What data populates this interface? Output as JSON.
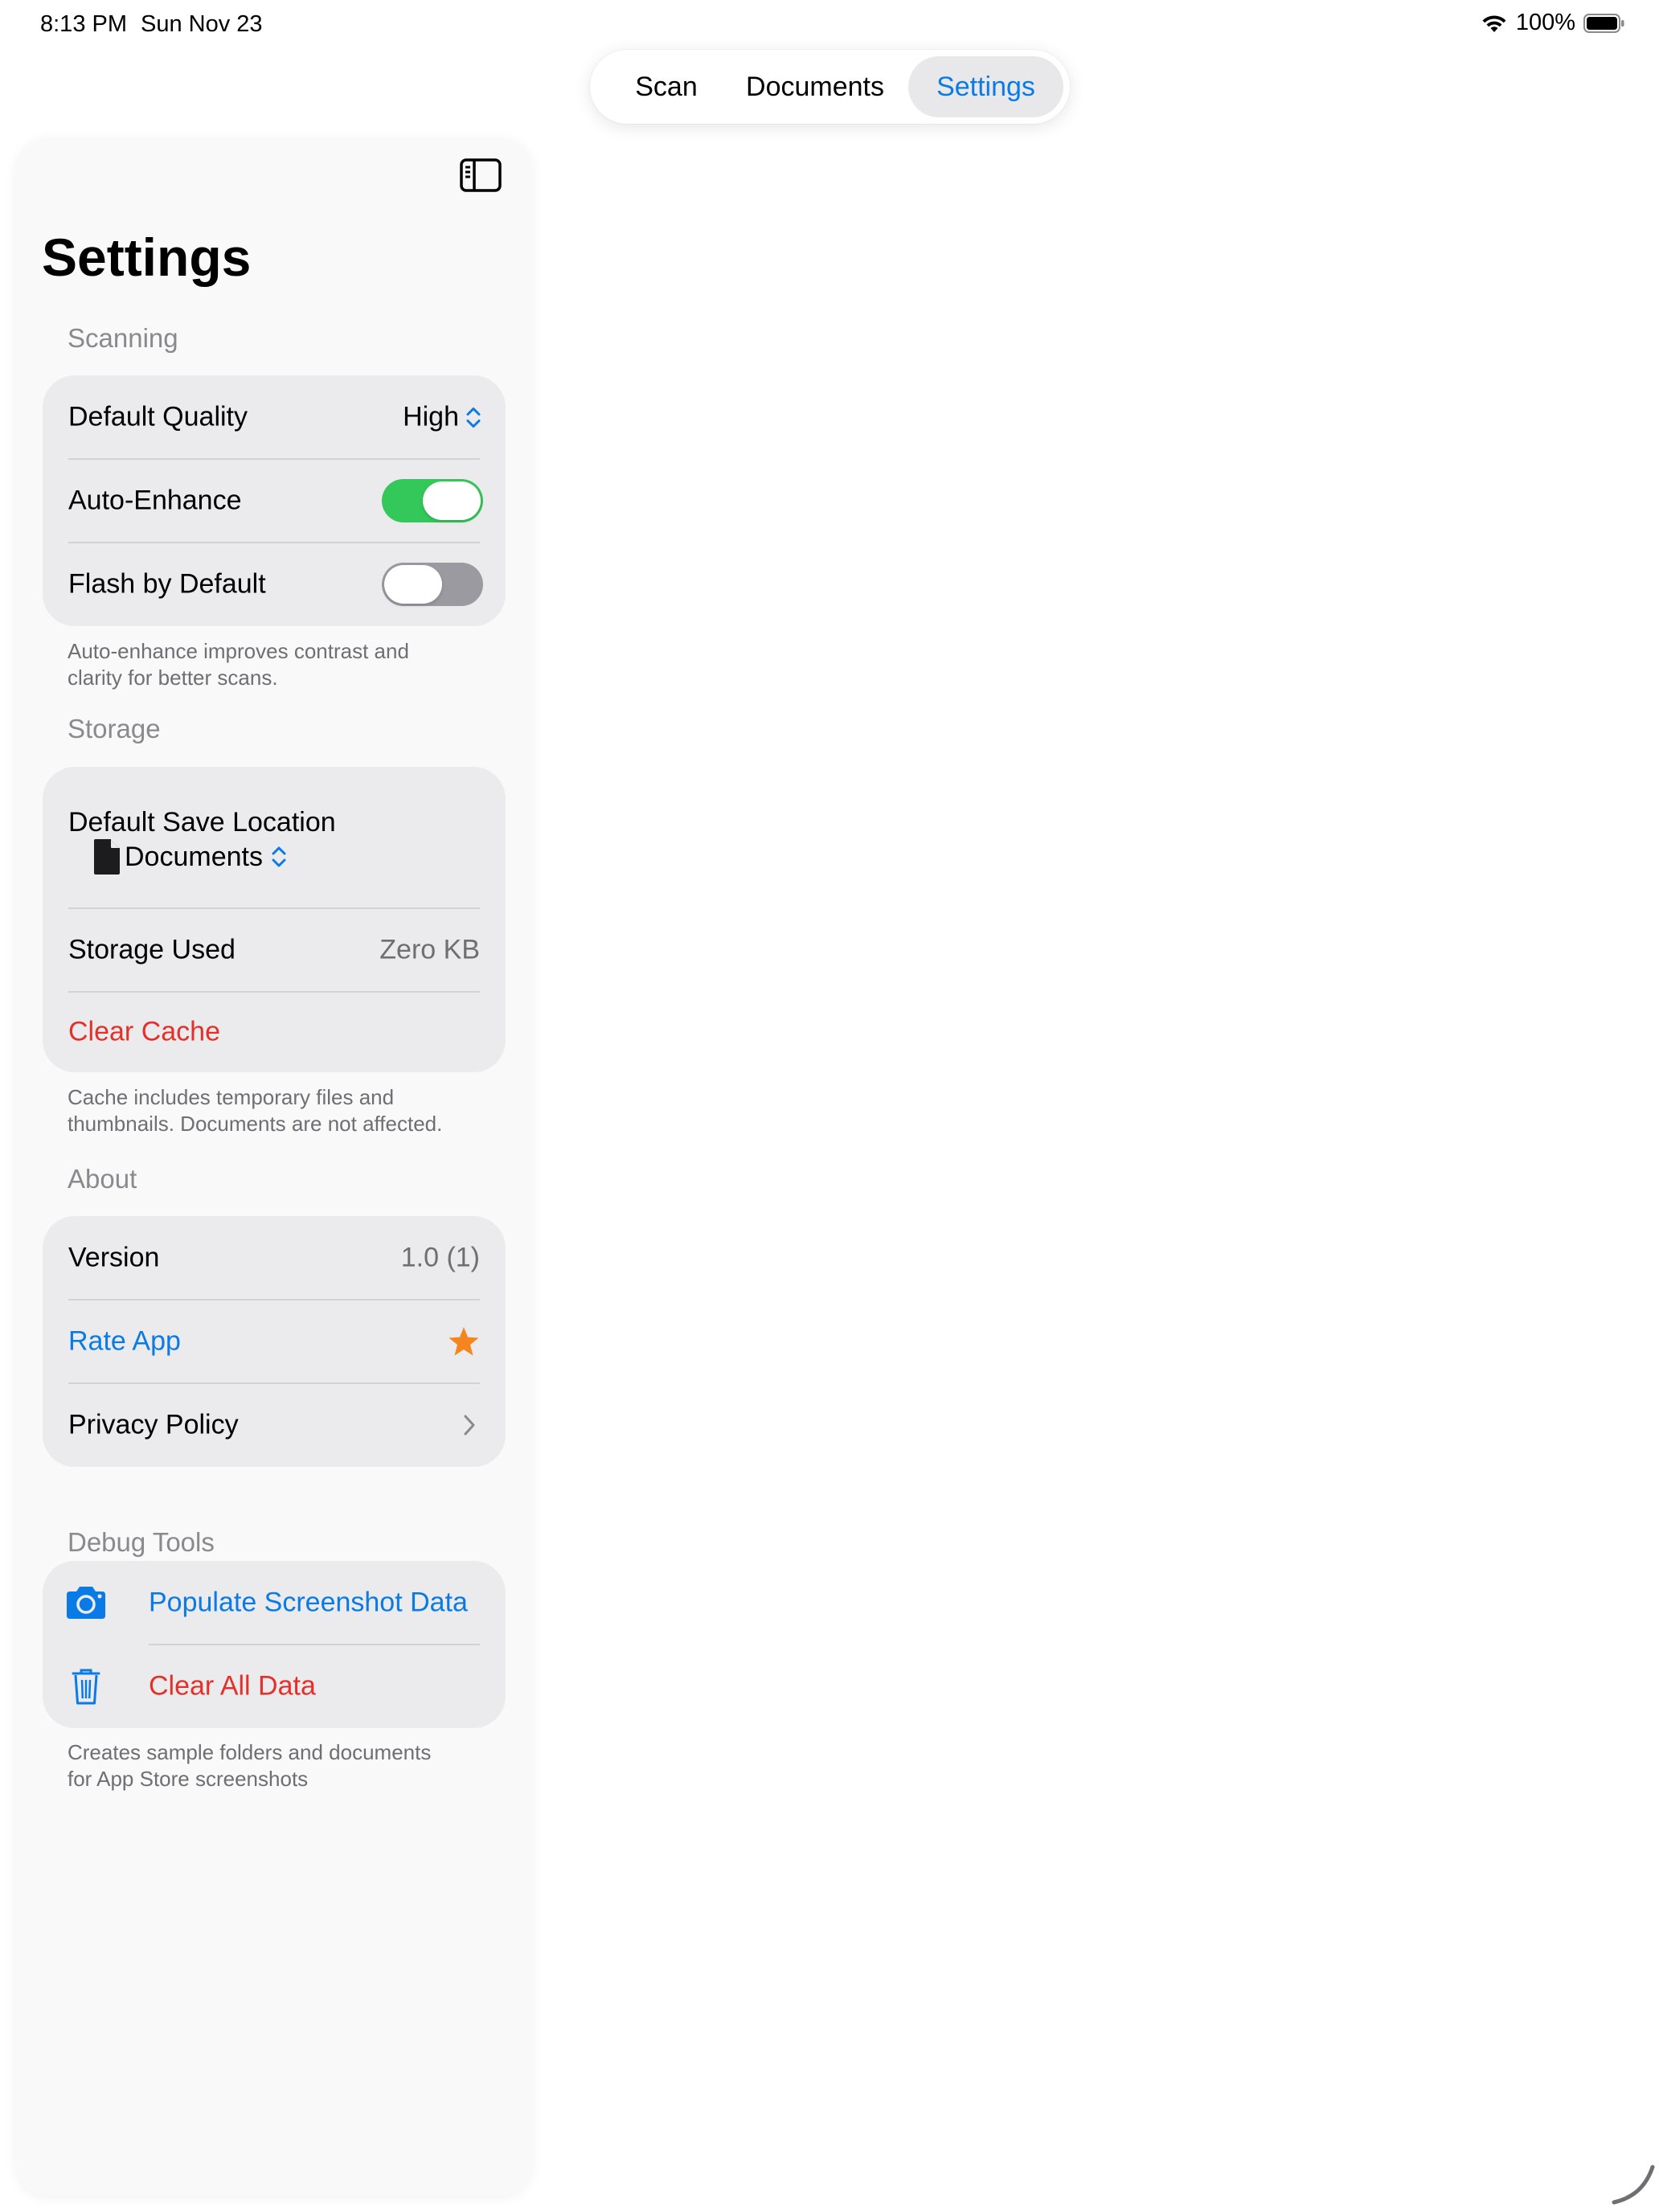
{
  "status_bar": {
    "time": "8:13 PM",
    "date": "Sun Nov 23",
    "battery_percent": "100%"
  },
  "tabs": [
    {
      "label": "Scan",
      "selected": false
    },
    {
      "label": "Documents",
      "selected": false
    },
    {
      "label": "Settings",
      "selected": true
    }
  ],
  "page": {
    "title": "Settings"
  },
  "scanning": {
    "header": "Scanning",
    "default_quality_label": "Default Quality",
    "default_quality_value": "High",
    "auto_enhance_label": "Auto-Enhance",
    "auto_enhance_on": true,
    "flash_label": "Flash by Default",
    "flash_on": false,
    "footer_line1": "Auto-enhance improves contrast and",
    "footer_line2": "clarity for better scans."
  },
  "storage": {
    "header": "Storage",
    "save_location_label": "Default Save Location",
    "save_location_value": "Documents",
    "storage_used_label": "Storage Used",
    "storage_used_value": "Zero KB",
    "clear_cache_label": "Clear Cache",
    "footer_line1": "Cache includes temporary files and",
    "footer_line2": "thumbnails. Documents are not affected."
  },
  "about": {
    "header": "About",
    "version_label": "Version",
    "version_value": "1.0 (1)",
    "rate_label": "Rate App",
    "privacy_label": "Privacy Policy"
  },
  "debug": {
    "header": "Debug Tools",
    "populate_label": "Populate Screenshot Data",
    "clear_label": "Clear All Data",
    "footer_line1": "Creates sample folders and documents",
    "footer_line2": "for App Store screenshots"
  },
  "colors": {
    "accent_blue": "#0a7be6",
    "destructive_red": "#e5302a",
    "toggle_green": "#34c759",
    "star_orange": "#f5851f"
  },
  "icons": [
    "wifi-icon",
    "battery-icon",
    "sidebar-toggle-icon",
    "chevron-updown-icon",
    "document-icon",
    "star-icon",
    "chevron-right-icon",
    "camera-icon",
    "trash-icon"
  ]
}
